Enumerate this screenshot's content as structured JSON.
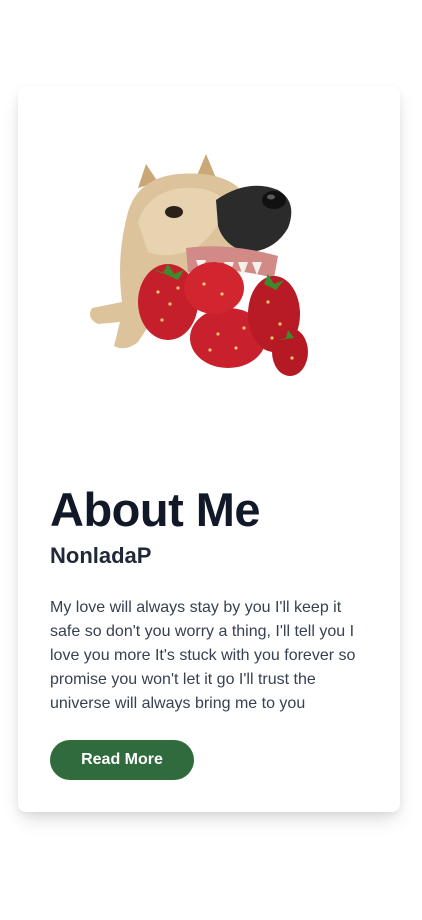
{
  "card": {
    "image_alt": "dog-biting-strawberries",
    "title": "About Me",
    "subtitle": "NonladaP",
    "body": "My love will always stay by you I'll keep it safe so don't you worry a thing, I'll tell you I love you more It's stuck with you forever so promise you won't let it go I'll trust the universe will always bring me to you",
    "button_label": "Read More",
    "button_color": "#2f6b3c"
  }
}
